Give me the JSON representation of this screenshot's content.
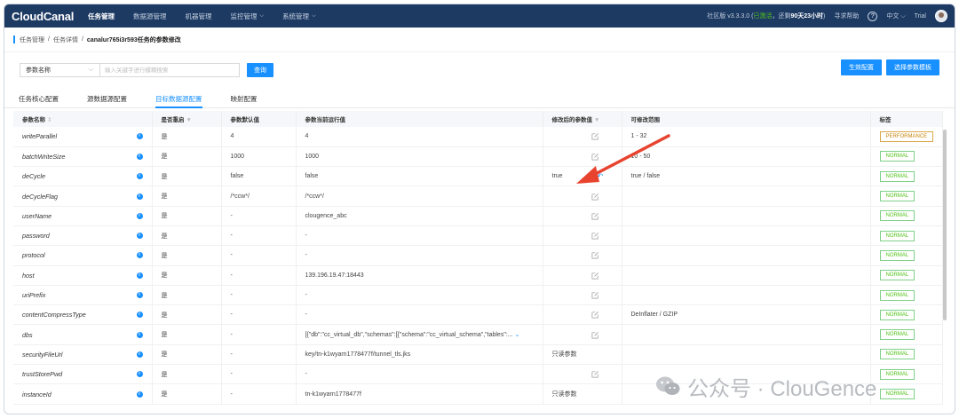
{
  "nav": {
    "logo": "CloudCanal",
    "items": [
      {
        "label": "任务管理",
        "active": true,
        "dropdown": false
      },
      {
        "label": "数据源管理",
        "active": false,
        "dropdown": false
      },
      {
        "label": "机器管理",
        "active": false,
        "dropdown": false
      },
      {
        "label": "监控管理",
        "active": false,
        "dropdown": true
      },
      {
        "label": "系统管理",
        "active": false,
        "dropdown": true
      }
    ],
    "edition": "社区版 v3.3.3.0",
    "trial_open": "(",
    "trial_status": "已激活",
    "trial_remain": "，还剩",
    "trial_days": "90天23小时",
    "trial_close": ")",
    "help_label": "寻求帮助",
    "help_icon": "?",
    "language": "中文",
    "user": "Trial"
  },
  "breadcrumb": {
    "items": [
      "任务管理",
      "/",
      "任务详情",
      "/"
    ],
    "current": "canalur765i3r593任务的参数修改"
  },
  "filter": {
    "select_value": "参数名称",
    "search_placeholder": "输入关键字进行模糊搜索",
    "query_label": "查询",
    "apply_label": "生效配置",
    "template_label": "选择参数模板"
  },
  "tabs": [
    {
      "label": "任务核心配置",
      "active": false
    },
    {
      "label": "源数据源配置",
      "active": false
    },
    {
      "label": "目标数据源配置",
      "active": true
    },
    {
      "label": "映射配置",
      "active": false
    }
  ],
  "table": {
    "columns": [
      "参数名称",
      "是否重启",
      "参数默认值",
      "参数当前运行值",
      "修改后的参数值",
      "可修改范围",
      "标签"
    ],
    "rows": [
      {
        "name": "writeParallel",
        "restart": "是",
        "default": "4",
        "current": "4",
        "new": "",
        "editable": true,
        "undo": false,
        "range": "1 - 32",
        "tag": "PERFORMANCE"
      },
      {
        "name": "batchWriteSize",
        "restart": "是",
        "default": "1000",
        "current": "1000",
        "new": "",
        "editable": true,
        "undo": false,
        "range": "10 - 50",
        "tag": "NORMAL"
      },
      {
        "name": "deCycle",
        "restart": "是",
        "default": "false",
        "current": "false",
        "new": "true",
        "editable": true,
        "undo": true,
        "range": "true / false",
        "tag": "NORMAL"
      },
      {
        "name": "deCycleFlag",
        "restart": "是",
        "default": "/*ccw*/",
        "current": "/*ccw*/",
        "new": "",
        "editable": true,
        "undo": false,
        "range": "",
        "tag": "NORMAL"
      },
      {
        "name": "userName",
        "restart": "是",
        "default": "-",
        "current": "clougence_abc",
        "new": "",
        "editable": true,
        "undo": false,
        "range": "",
        "tag": "NORMAL"
      },
      {
        "name": "password",
        "restart": "是",
        "default": "-",
        "current": "-",
        "new": "",
        "editable": true,
        "undo": false,
        "range": "",
        "tag": "NORMAL"
      },
      {
        "name": "protocol",
        "restart": "是",
        "default": "-",
        "current": "-",
        "new": "",
        "editable": true,
        "undo": false,
        "range": "",
        "tag": "NORMAL"
      },
      {
        "name": "host",
        "restart": "是",
        "default": "-",
        "current": "139.196.19.47:18443",
        "new": "",
        "editable": true,
        "undo": false,
        "range": "",
        "tag": "NORMAL"
      },
      {
        "name": "uriPrefix",
        "restart": "是",
        "default": "-",
        "current": "-",
        "new": "",
        "editable": true,
        "undo": false,
        "range": "",
        "tag": "NORMAL"
      },
      {
        "name": "contentCompressType",
        "restart": "是",
        "default": "-",
        "current": "-",
        "new": "",
        "editable": true,
        "undo": false,
        "range": "DeInflater / GZIP",
        "tag": "NORMAL"
      },
      {
        "name": "dbs",
        "restart": "是",
        "default": "-",
        "current": "[{\"db\":\"cc_virtual_db\",\"schemas\":[{\"schema\":\"cc_virtual_schema\",\"tables\":...",
        "new": "",
        "editable": true,
        "undo": false,
        "range": "",
        "tag": "NORMAL"
      },
      {
        "name": "securityFileUrl",
        "restart": "是",
        "default": "-",
        "current": "key/tn-k1wyarn1778477f/tunnel_tls.jks",
        "new": "只读参数",
        "editable": false,
        "undo": false,
        "range": "",
        "tag": "NORMAL"
      },
      {
        "name": "trustStorePwd",
        "restart": "是",
        "default": "-",
        "current": "-",
        "new": "",
        "editable": true,
        "undo": false,
        "range": "",
        "tag": "NORMAL"
      },
      {
        "name": "instanceId",
        "restart": "是",
        "default": "-",
        "current": "tn-k1wyarn1778477f",
        "new": "只读参数",
        "editable": false,
        "undo": false,
        "range": "",
        "tag": "NORMAL"
      }
    ]
  },
  "watermark": {
    "text": "公众号 · ClouGence",
    "icon": "wechat-icon"
  },
  "colors": {
    "nav_bg": "#1d3a63",
    "primary": "#1890ff",
    "tag_normal": "#52c41a",
    "tag_perf": "#c9860e",
    "arrow": "#e8432f"
  }
}
